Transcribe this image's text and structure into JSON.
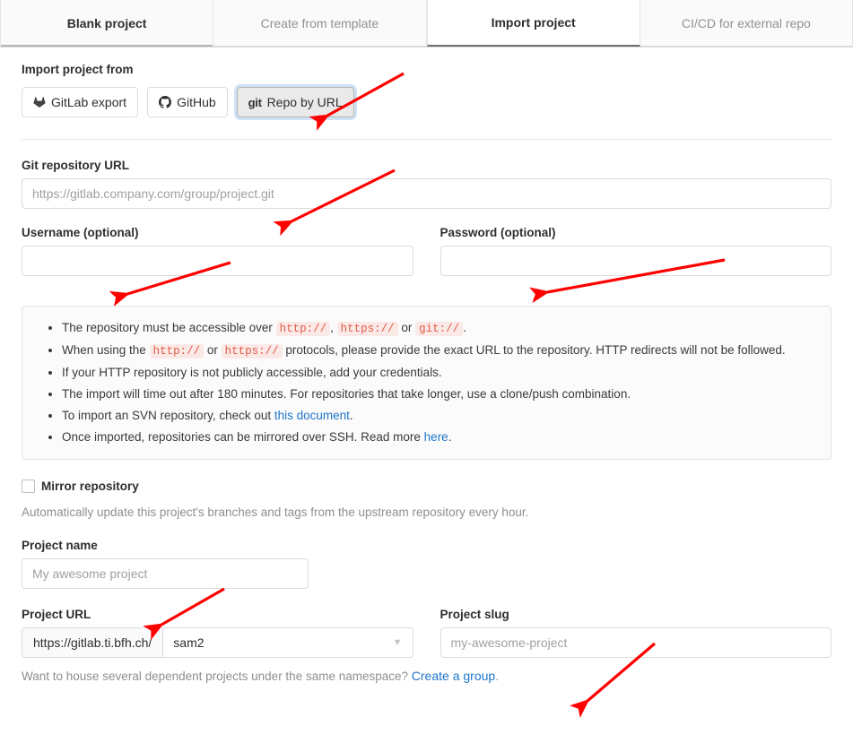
{
  "tabs": [
    {
      "label": "Blank project",
      "state": "inactive-dark"
    },
    {
      "label": "Create from template",
      "state": "inactive"
    },
    {
      "label": "Import project",
      "state": "active"
    },
    {
      "label": "CI/CD for external repo",
      "state": "inactive"
    }
  ],
  "import_from": {
    "heading": "Import project from",
    "buttons": [
      {
        "label": "GitLab export",
        "icon": "gitlab-logo-icon",
        "selected": false
      },
      {
        "label": "GitHub",
        "icon": "github-logo-icon",
        "selected": false
      },
      {
        "label": "Repo by URL",
        "icon": "git-logo-icon",
        "selected": true
      }
    ]
  },
  "git_url": {
    "label": "Git repository URL",
    "value": "",
    "placeholder": "https://gitlab.company.com/group/project.git"
  },
  "username": {
    "label": "Username (optional)",
    "value": "",
    "placeholder": ""
  },
  "password": {
    "label": "Password (optional)",
    "value": "",
    "placeholder": ""
  },
  "info": {
    "bullets": [
      {
        "parts": [
          {
            "t": "text",
            "v": "The repository must be accessible over "
          },
          {
            "t": "code",
            "v": "http://"
          },
          {
            "t": "text",
            "v": ", "
          },
          {
            "t": "code",
            "v": "https://"
          },
          {
            "t": "text",
            "v": " or "
          },
          {
            "t": "code",
            "v": "git://"
          },
          {
            "t": "text",
            "v": "."
          }
        ]
      },
      {
        "parts": [
          {
            "t": "text",
            "v": "When using the "
          },
          {
            "t": "code",
            "v": "http://"
          },
          {
            "t": "text",
            "v": " or "
          },
          {
            "t": "code",
            "v": "https://"
          },
          {
            "t": "text",
            "v": " protocols, please provide the exact URL to the repository. HTTP redirects will not be followed."
          }
        ]
      },
      {
        "parts": [
          {
            "t": "text",
            "v": "If your HTTP repository is not publicly accessible, add your credentials."
          }
        ]
      },
      {
        "parts": [
          {
            "t": "text",
            "v": "The import will time out after 180 minutes. For repositories that take longer, use a clone/push combination."
          }
        ]
      },
      {
        "parts": [
          {
            "t": "text",
            "v": "To import an SVN repository, check out "
          },
          {
            "t": "link",
            "v": "this document"
          },
          {
            "t": "text",
            "v": "."
          }
        ]
      },
      {
        "parts": [
          {
            "t": "text",
            "v": "Once imported, repositories can be mirrored over SSH. Read more "
          },
          {
            "t": "link",
            "v": "here"
          },
          {
            "t": "text",
            "v": "."
          }
        ]
      }
    ]
  },
  "mirror": {
    "label": "Mirror repository",
    "checked": false,
    "help": "Automatically update this project's branches and tags from the upstream repository every hour."
  },
  "project_name": {
    "label": "Project name",
    "value": "",
    "placeholder": "My awesome project"
  },
  "project_url": {
    "label": "Project URL",
    "prefix": "https://gitlab.ti.bfh.ch/",
    "namespace": "sam2"
  },
  "project_slug": {
    "label": "Project slug",
    "value": "",
    "placeholder": "my-awesome-project"
  },
  "footer": {
    "text": "Want to house several dependent projects under the same namespace? ",
    "link": "Create a group",
    "suffix": "."
  },
  "colors": {
    "accent_link": "#1f75cb",
    "annotation_arrow": "#ff0000",
    "code_bg": "#fbe9e7",
    "code_fg": "#e05c48",
    "focus_ring": "#cfe2f7"
  }
}
